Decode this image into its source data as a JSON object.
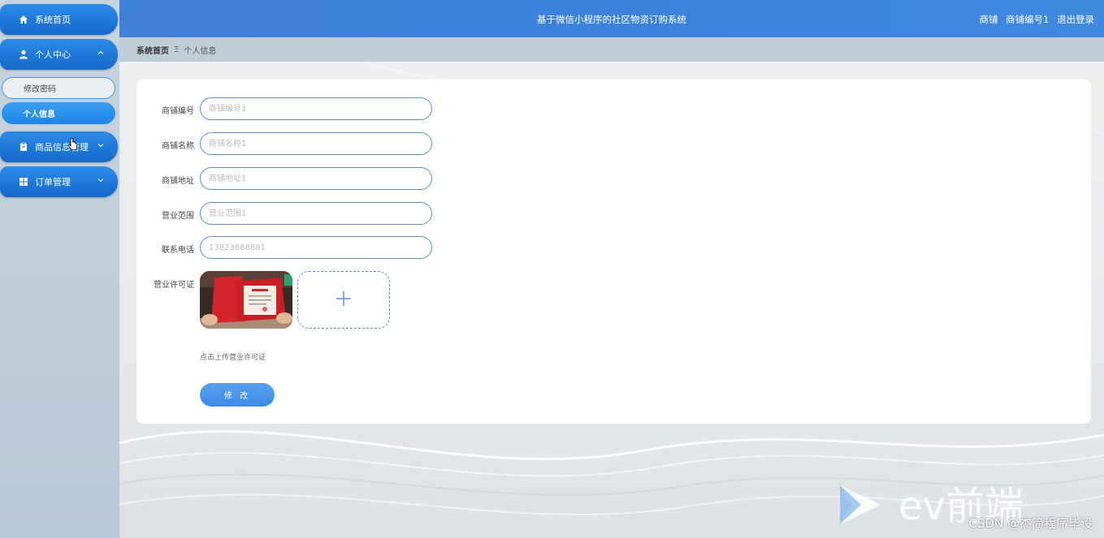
{
  "header": {
    "title": "基于微信小程序的社区物资订购系统",
    "user_role": "商铺",
    "user_name": "商铺编号1",
    "logout": "退出登录"
  },
  "sidebar": {
    "items": [
      {
        "label": "系统首页",
        "icon": "home-icon"
      },
      {
        "label": "个人中心",
        "icon": "user-icon",
        "expanded": true,
        "children": [
          {
            "label": "修改密码"
          },
          {
            "label": "个人信息",
            "active": true
          }
        ]
      },
      {
        "label": "商品信息管理",
        "icon": "goods-icon"
      },
      {
        "label": "订单管理",
        "icon": "grid-icon"
      }
    ]
  },
  "breadcrumb": {
    "home": "系统首页",
    "separator": "Ξ",
    "current": "个人信息"
  },
  "form": {
    "fields": [
      {
        "label": "商铺编号",
        "placeholder": "商铺编号1"
      },
      {
        "label": "商铺名称",
        "placeholder": "商铺名称1"
      },
      {
        "label": "商铺地址",
        "placeholder": "商铺地址1"
      },
      {
        "label": "营业范围",
        "placeholder": "营业范围1"
      },
      {
        "label": "联系电话",
        "placeholder": "13823888881"
      }
    ],
    "license_label": "营业许可证",
    "upload_hint": "点击上传营业许可证",
    "submit_label": "修 改"
  },
  "watermark": {
    "logo": "ev前端",
    "text": "CSDN @杰简程序毕设"
  },
  "colors": {
    "primary": "#1f7fe0",
    "header": "#3f82dc",
    "accent": "#5aa2f0"
  }
}
